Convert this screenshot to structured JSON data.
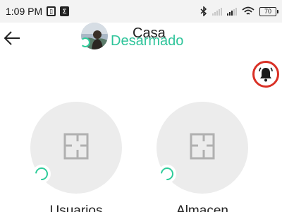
{
  "status_bar": {
    "time": "1:09 PM",
    "notification_icons": [
      "screenshot-icon",
      "sigma-icon"
    ],
    "battery": "70"
  },
  "header": {
    "title": "Casa",
    "status": "Desarmado",
    "back_icon": "back-arrow-icon"
  },
  "alarm": {
    "icon": "bell-icon",
    "ring_color": "#d93025",
    "icon_color": "#1a1a1a"
  },
  "devices": [
    {
      "label": "Usuarios",
      "icon": "floor-plan-icon"
    },
    {
      "label": "Almacen",
      "icon": "floor-plan-icon"
    }
  ],
  "colors": {
    "accent": "#2ec49a",
    "alert": "#d93025",
    "circle_bg": "#ececec"
  }
}
